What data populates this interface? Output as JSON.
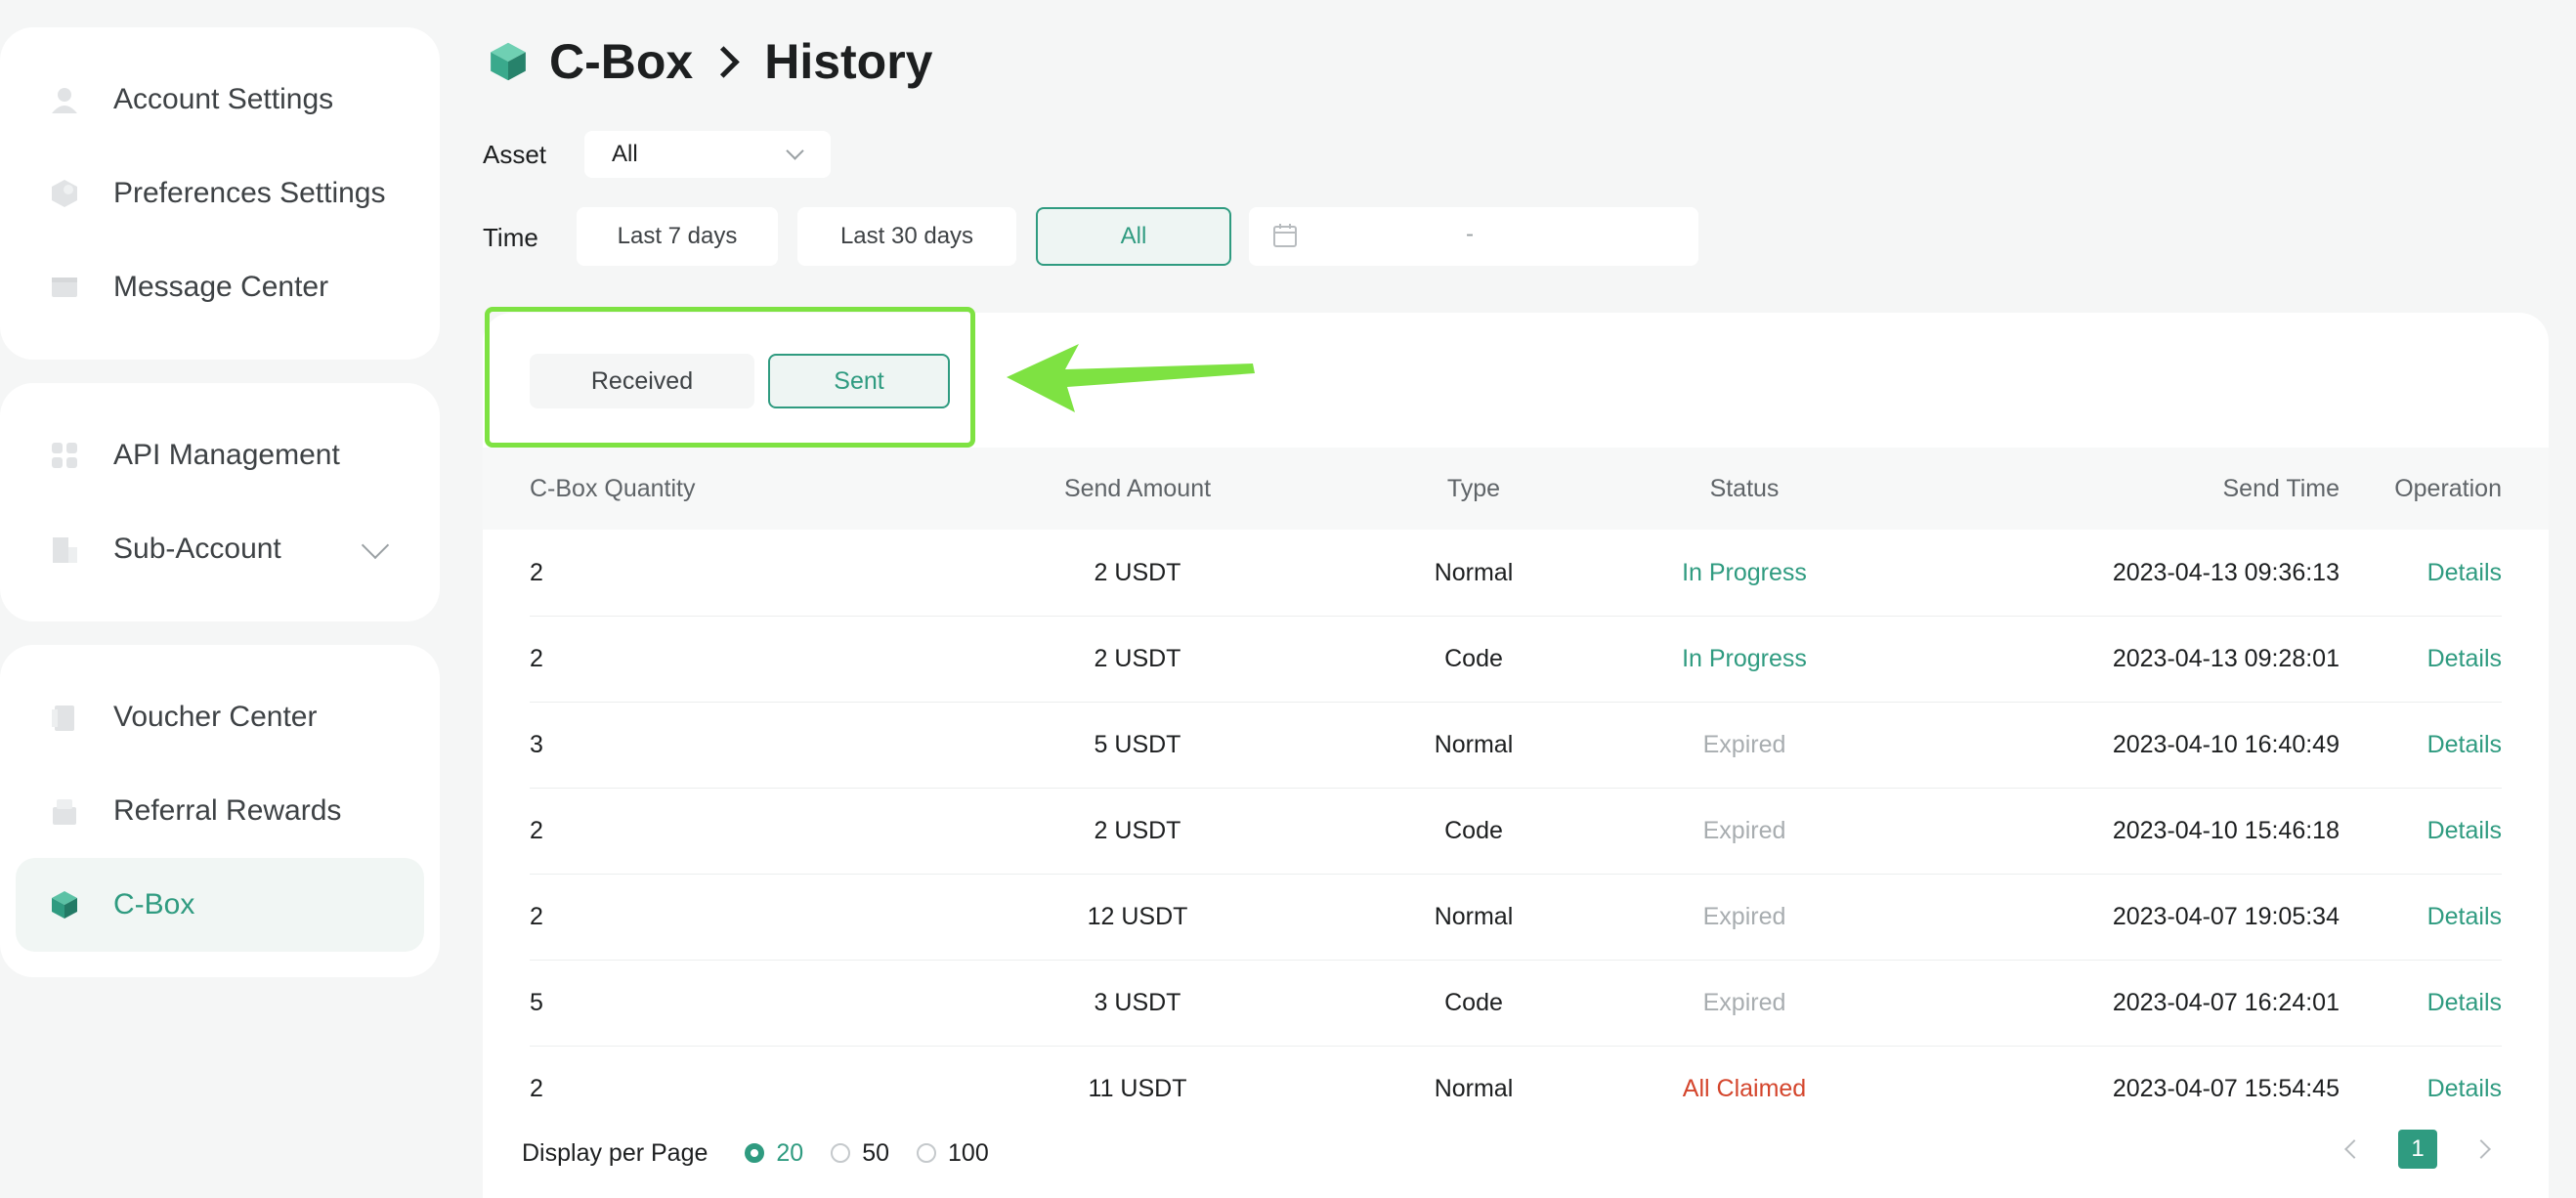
{
  "sidebar": {
    "groups": [
      [
        {
          "label": "Account Settings",
          "icon": "user-icon"
        },
        {
          "label": "Preferences Settings",
          "icon": "preferences-icon"
        },
        {
          "label": "Message Center",
          "icon": "message-icon"
        }
      ],
      [
        {
          "label": "API Management",
          "icon": "api-icon"
        },
        {
          "label": "Sub-Account",
          "icon": "sub-account-icon"
        }
      ],
      [
        {
          "label": "Voucher Center",
          "icon": "voucher-icon"
        },
        {
          "label": "Referral Rewards",
          "icon": "referral-icon"
        },
        {
          "label": "C-Box",
          "icon": "cbox-icon",
          "active": true
        }
      ]
    ]
  },
  "header": {
    "crumb1": "C-Box",
    "crumb2": "History"
  },
  "filters": {
    "asset_label": "Asset",
    "asset_value": "All",
    "time_label": "Time",
    "time_options": [
      "Last 7 days",
      "Last 30 days",
      "All"
    ],
    "time_selected": "All",
    "date_separator": "-"
  },
  "tabs": {
    "received": "Received",
    "sent": "Sent",
    "active": "Sent"
  },
  "table": {
    "headers": [
      "C-Box Quantity",
      "Send Amount",
      "Type",
      "Status",
      "Send Time",
      "Operation"
    ],
    "rows": [
      {
        "qty": "2",
        "amount": "2 USDT",
        "type": "Normal",
        "status": "In Progress",
        "status_kind": "progress",
        "time": "2023-04-13 09:36:13",
        "op": "Details"
      },
      {
        "qty": "2",
        "amount": "2 USDT",
        "type": "Code",
        "status": "In Progress",
        "status_kind": "progress",
        "time": "2023-04-13 09:28:01",
        "op": "Details"
      },
      {
        "qty": "3",
        "amount": "5 USDT",
        "type": "Normal",
        "status": "Expired",
        "status_kind": "expired",
        "time": "2023-04-10 16:40:49",
        "op": "Details"
      },
      {
        "qty": "2",
        "amount": "2 USDT",
        "type": "Code",
        "status": "Expired",
        "status_kind": "expired",
        "time": "2023-04-10 15:46:18",
        "op": "Details"
      },
      {
        "qty": "2",
        "amount": "12 USDT",
        "type": "Normal",
        "status": "Expired",
        "status_kind": "expired",
        "time": "2023-04-07 19:05:34",
        "op": "Details"
      },
      {
        "qty": "5",
        "amount": "3 USDT",
        "type": "Code",
        "status": "Expired",
        "status_kind": "expired",
        "time": "2023-04-07 16:24:01",
        "op": "Details"
      },
      {
        "qty": "2",
        "amount": "11 USDT",
        "type": "Normal",
        "status": "All Claimed",
        "status_kind": "claimed",
        "time": "2023-04-07 15:54:45",
        "op": "Details"
      }
    ]
  },
  "footer": {
    "per_page_label": "Display per Page",
    "per_page_options": [
      "20",
      "50",
      "100"
    ],
    "per_page_selected": "20",
    "current_page": "1"
  },
  "colors": {
    "accent": "#2f9b80",
    "highlight": "#7ee242",
    "claimed": "#d4462d",
    "expired": "#a8adb0"
  }
}
